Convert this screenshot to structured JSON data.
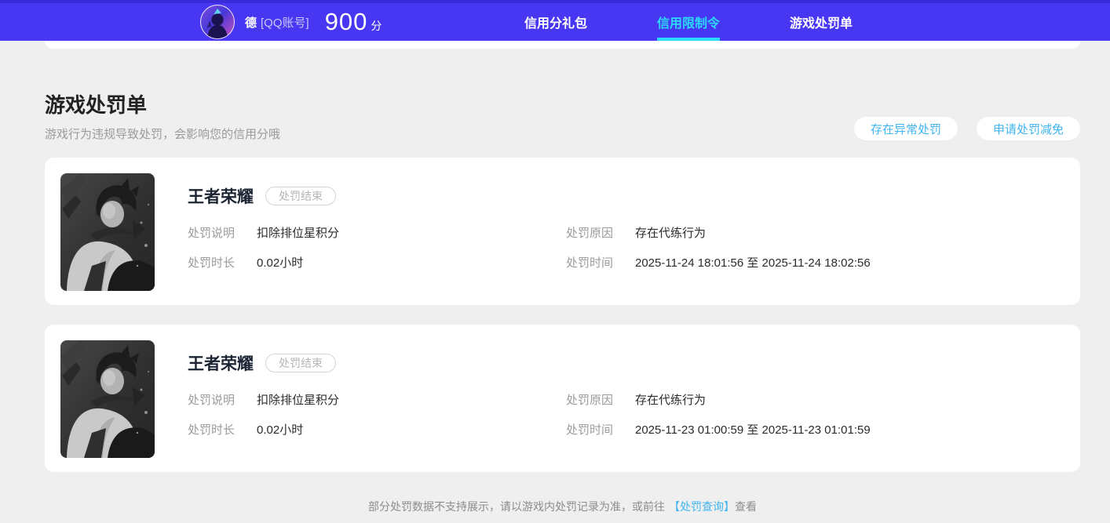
{
  "header": {
    "nickname": "德",
    "account_label": "[QQ账号]",
    "score": "900",
    "score_unit": "分",
    "tabs": [
      {
        "label": "信用分礼包"
      },
      {
        "label": "信用限制令"
      },
      {
        "label": "游戏处罚单"
      }
    ],
    "active_tab_index": 1
  },
  "section": {
    "title": "游戏处罚单",
    "subtitle": "游戏行为违规导致处罚，会影响您的信用分哦",
    "action_abnormal": "存在异常处罚",
    "action_reduction": "申请处罚减免"
  },
  "cards": [
    {
      "game_title": "王者荣耀",
      "status": "处罚结束",
      "rows": [
        {
          "left_label": "处罚说明",
          "left_value": "扣除排位星积分",
          "right_label": "处罚原因",
          "right_value": "存在代练行为"
        },
        {
          "left_label": "处罚时长",
          "left_value": "0.02小时",
          "right_label": "处罚时间",
          "right_value": "2025-11-24 18:01:56 至 2025-11-24 18:02:56"
        }
      ]
    },
    {
      "game_title": "王者荣耀",
      "status": "处罚结束",
      "rows": [
        {
          "left_label": "处罚说明",
          "left_value": "扣除排位星积分",
          "right_label": "处罚原因",
          "right_value": "存在代练行为"
        },
        {
          "left_label": "处罚时长",
          "left_value": "0.02小时",
          "right_label": "处罚时间",
          "right_value": "2025-11-23 01:00:59 至 2025-11-23 01:01:59"
        }
      ]
    }
  ],
  "footer": {
    "text": "部分处罚数据不支持展示，请以游戏内处罚记录为准，或前往",
    "link": "【处罚查询】",
    "suffix": "查看"
  },
  "colors": {
    "header_bg": "#4837f2",
    "active_tab_cyan": "#2bd9fb",
    "accent_blue": "#41b4f2",
    "page_bg": "#efefef"
  }
}
